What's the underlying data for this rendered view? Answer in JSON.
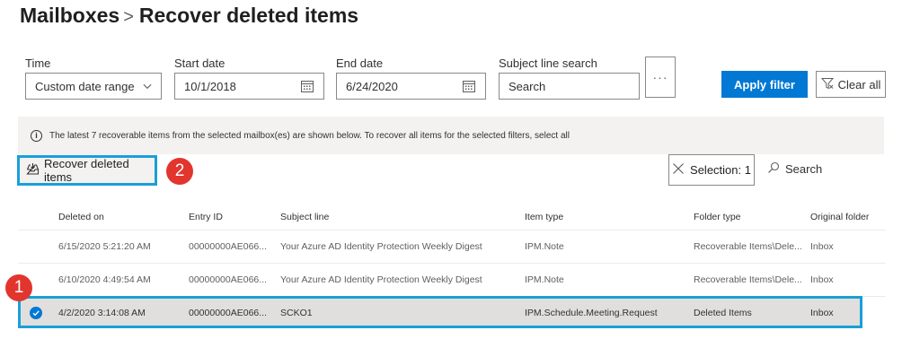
{
  "header": {
    "breadcrumb_parent": "Mailboxes",
    "separator": ">",
    "page_title": "Recover deleted items"
  },
  "filters": {
    "time_label": "Time",
    "time_value": "Custom date range",
    "start_label": "Start date",
    "start_value": "10/1/2018",
    "end_label": "End date",
    "end_value": "6/24/2020",
    "subject_label": "Subject line search",
    "subject_placeholder": "Search",
    "more_label": "···",
    "apply_label": "Apply filter",
    "clear_label": "Clear all"
  },
  "info": {
    "text": "The latest 7 recoverable items from the selected mailbox(es) are shown below. To recover all items for the selected filters, select all"
  },
  "toolbar": {
    "recover_label": "Recover deleted items",
    "selection_label": "Selection: 1",
    "search_label": "Search"
  },
  "annotations": {
    "badge_1": "1",
    "badge_2": "2"
  },
  "table": {
    "columns": [
      "Deleted on",
      "Entry ID",
      "Subject line",
      "Item type",
      "Folder type",
      "Original folder"
    ],
    "rows": [
      [
        "6/15/2020 5:21:20 AM",
        "00000000AE066...",
        "Your Azure AD Identity Protection Weekly Digest",
        "IPM.Note",
        "Recoverable Items\\Dele...",
        "Inbox"
      ],
      [
        "6/10/2020 4:49:54 AM",
        "00000000AE066...",
        "Your Azure AD Identity Protection Weekly Digest",
        "IPM.Note",
        "Recoverable Items\\Dele...",
        "Inbox"
      ],
      [
        "4/2/2020 3:14:08 AM",
        "00000000AE066...",
        "SCKO1",
        "IPM.Schedule.Meeting.Request",
        "Deleted Items",
        "Inbox"
      ]
    ],
    "selected_row": 2
  },
  "colors": {
    "accent": "#0078d4",
    "highlight_border": "#1a9fd8",
    "badge": "#e2352e"
  }
}
